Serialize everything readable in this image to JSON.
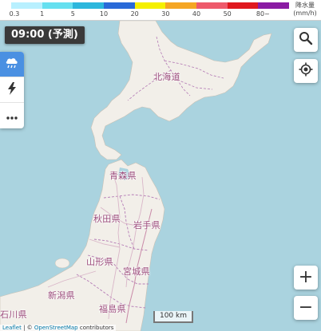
{
  "legend": {
    "ticks": [
      "0.3",
      "1",
      "5",
      "10",
      "20",
      "30",
      "40",
      "50",
      "80~"
    ],
    "colors": [
      "#b8f0ff",
      "#66e0f0",
      "#2cb7dd",
      "#2a6ad8",
      "#f5f000",
      "#f5a623",
      "#ee5a6b",
      "#e0181e",
      "#8a1ba3"
    ],
    "unit_line1": "降水量",
    "unit_line2": "(mm/h)"
  },
  "time_label": "09:00 (予測)",
  "layers": [
    {
      "name": "rain-cloud-icon",
      "active": true
    },
    {
      "name": "lightning-icon",
      "active": false
    },
    {
      "name": "more-icon",
      "active": false
    }
  ],
  "map": {
    "land_color": "#f2efe9",
    "water_color": "#aad3df",
    "border_color": "#b47bb5",
    "labels": {
      "hokkaido": "北海道",
      "aomori": "青森県",
      "akita": "秋田県",
      "iwate": "岩手県",
      "yamagata": "山形県",
      "miyagi": "宮城県",
      "niigata": "新潟県",
      "fukushima": "福島県",
      "ishikawa": "石川県"
    }
  },
  "controls": {
    "search_icon": "search-icon",
    "locate_icon": "locate-icon",
    "zoom_in": "+",
    "zoom_out": "−"
  },
  "scale": "100 km",
  "attribution": {
    "leaflet": "Leaflet",
    "separator": " | © ",
    "osm": "OpenStreetMap",
    "contributors": " contributors"
  }
}
